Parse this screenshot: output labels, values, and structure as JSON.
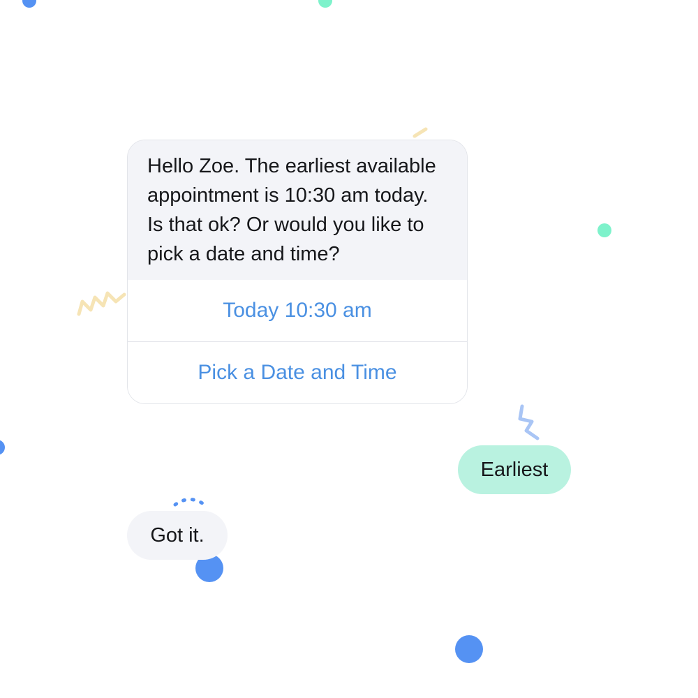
{
  "theme": {
    "accent": "#4a90e2",
    "bot_bubble_bg": "#f3f4f8",
    "user_bubble_bg": "#b9f2e0",
    "confetti_blue": "#5592f3",
    "confetti_mint": "#7ef2cb",
    "confetti_yellow": "#f6e4b5",
    "confetti_light_blue": "#a9c5f5"
  },
  "conversation": {
    "bot_prompt": {
      "message": "Hello Zoe. The earliest available appointment is 10:30 am today. Is that ok? Or would you like to pick a date and time?",
      "options": [
        {
          "label": "Today 10:30 am"
        },
        {
          "label": "Pick a Date and Time"
        }
      ]
    },
    "user_reply": {
      "text": "Earliest"
    },
    "bot_ack": {
      "text": "Got it."
    }
  }
}
